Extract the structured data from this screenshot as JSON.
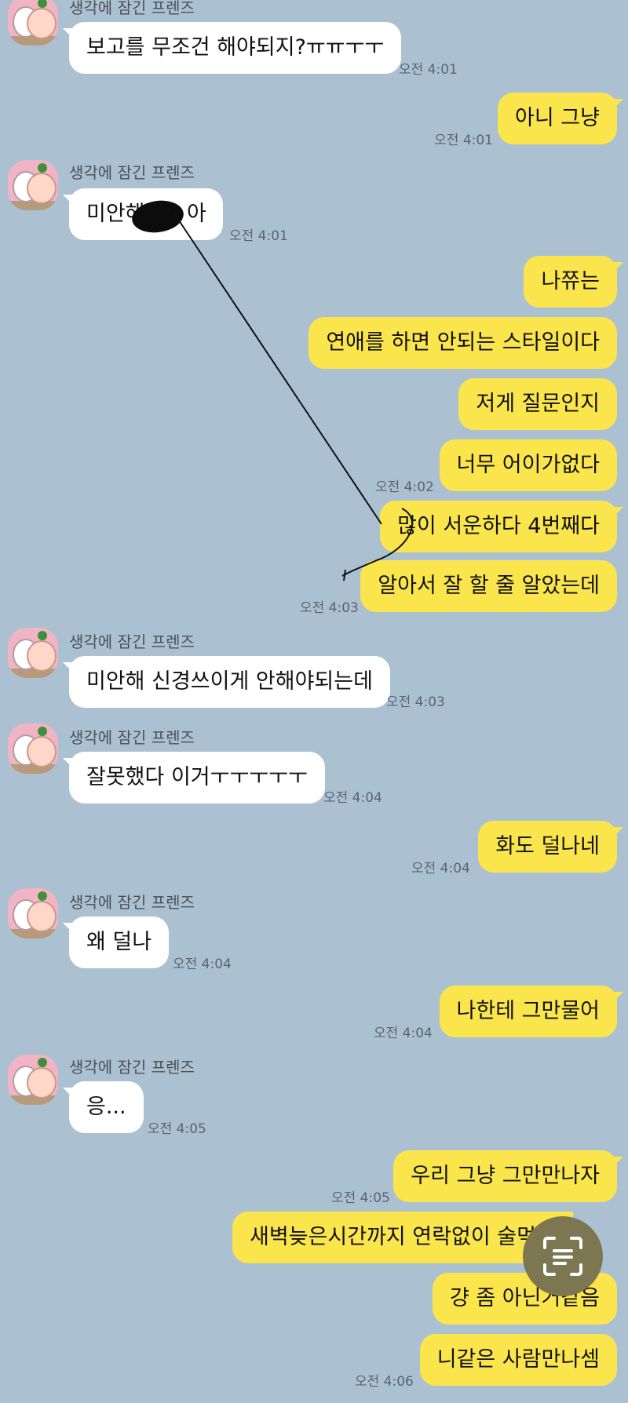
{
  "app": "KakaoTalk chat",
  "sender_name": "생각에 잠긴 프렌즈",
  "colors": {
    "background": "#abc1d1",
    "my_bubble": "#fbe54d",
    "their_bubble": "#ffffff"
  },
  "messages": [
    {
      "side": "left",
      "text": "보고를 무조건 해야되지?ㅠㅠㅜㅜ",
      "time": "오전 4:01"
    },
    {
      "side": "right",
      "text": "아니 그냥",
      "time": "오전 4:01"
    },
    {
      "side": "left",
      "text": "미안해 ",
      "text_after_scribble": "아",
      "time": "오전 4:01"
    },
    {
      "side": "right",
      "text": "나쮸는"
    },
    {
      "side": "right",
      "text": "연애를 하면 안되는 스타일이다"
    },
    {
      "side": "right",
      "text": "저게 질문인지"
    },
    {
      "side": "right",
      "text": "너무 어이가없다",
      "time": "오전 4:02"
    },
    {
      "side": "right",
      "text": "많이 서운하다 4번째다"
    },
    {
      "side": "right",
      "text": "알아서 잘 할 줄 알았는데",
      "time": "오전 4:03"
    },
    {
      "side": "left",
      "text": "미안해 신경쓰이게 안해야되는데",
      "time": "오전 4:03"
    },
    {
      "side": "left",
      "text": "잘못했다 이거ㅜㅜㅜㅜㅜ",
      "time": "오전 4:04"
    },
    {
      "side": "right",
      "text": "화도 덜나네",
      "time": "오전 4:04"
    },
    {
      "side": "left",
      "text": "왜 덜나",
      "time": "오전 4:04"
    },
    {
      "side": "right",
      "text": "나한테 그만물어",
      "time": "오전 4:04"
    },
    {
      "side": "left",
      "text": "응...",
      "time": "오전 4:05"
    },
    {
      "side": "right",
      "text": "우리 그냥 그만만나자",
      "time": "오전 4:05"
    },
    {
      "side": "right",
      "text": "새벽늦은시간까지 연락없이 술먹는"
    },
    {
      "side": "right",
      "text": "걍 좀 아닌거같음"
    },
    {
      "side": "right",
      "text": "니같은 사람만나셈",
      "time": "오전 4:06"
    }
  ],
  "overlay_button_icon": "text-scan-icon"
}
